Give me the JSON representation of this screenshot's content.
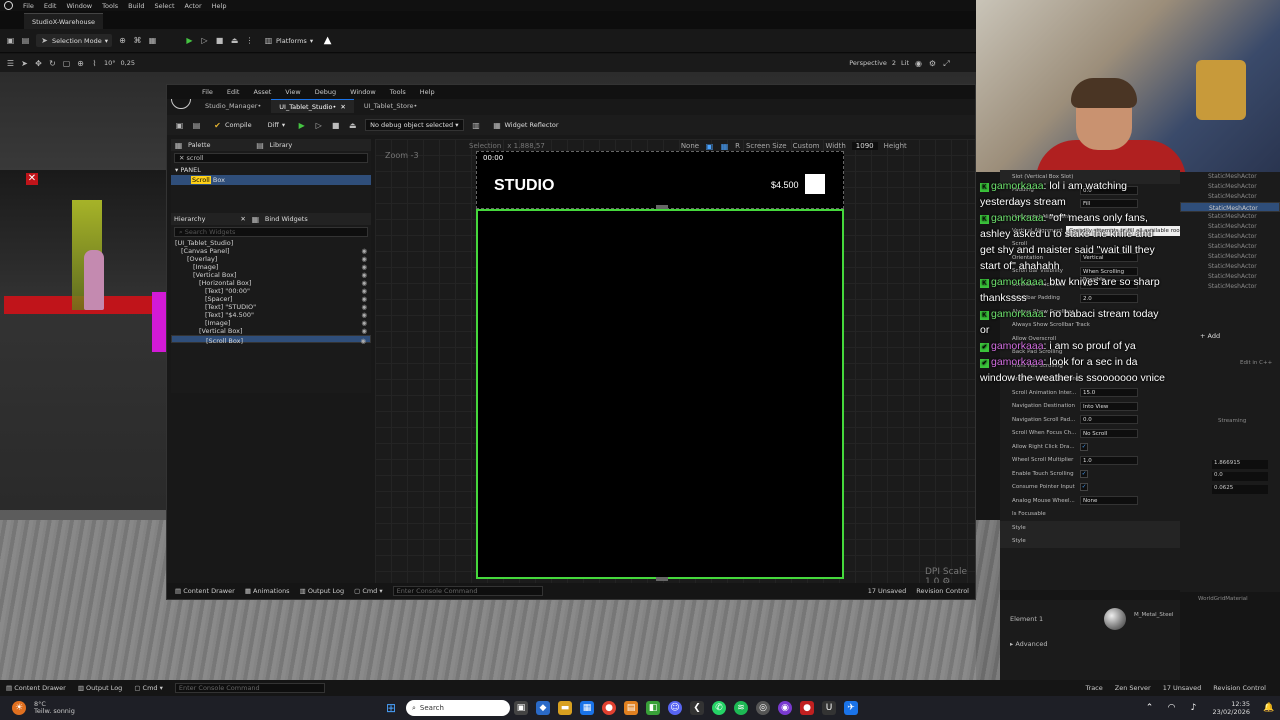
{
  "main_window": {
    "menu": [
      "File",
      "Edit",
      "Window",
      "Tools",
      "Build",
      "Select",
      "Actor",
      "Help"
    ],
    "tab": "StudioX-Warehouse",
    "toolbar": {
      "selection_mode": "Selection Mode",
      "platforms": "Platforms"
    },
    "viewport": {
      "perspective": "Perspective",
      "lit": "Lit",
      "snap_angle": "10°",
      "scale": "0,25",
      "grid_count": "2"
    }
  },
  "widget_editor": {
    "menu": [
      "File",
      "Edit",
      "Asset",
      "View",
      "Debug",
      "Window",
      "Tools",
      "Help"
    ],
    "tabs": [
      "Studio_Manager•",
      "UI_Tablet_Studio•",
      "UI_Tablet_Store•"
    ],
    "toolbar": {
      "compile": "Compile",
      "diff": "Diff",
      "debug_select": "No debug object selected",
      "widget_reflector": "Widget Reflector"
    },
    "palette": {
      "title": "Palette",
      "library": "Library",
      "search": "scroll",
      "category": "PANEL",
      "item_hl": "Scroll",
      "item_rest": " Box"
    },
    "hierarchy": {
      "title": "Hierarchy",
      "bind": "Bind Widgets",
      "search_placeholder": "Search Widgets",
      "nodes": [
        "[UI_Tablet_Studio]",
        "[Canvas Panel]",
        "[Overlay]",
        "[Image]",
        "[Vertical Box]",
        "[Horizontal Box]",
        "[Text] \"00:00\"",
        "[Spacer]",
        "[Text] \"STUDIO\"",
        "[Text] \"$4.500\"",
        "[Image]",
        "[Vertical Box]",
        "[Scroll Box]"
      ]
    },
    "designer": {
      "zoom": "Zoom -3",
      "selection": "Selection",
      "size_readout": "x 1.888,57",
      "screen_size": "Screen Size",
      "custom": "Custom",
      "width_label": "Width",
      "width": "1090",
      "height_label": "Height",
      "none": "None",
      "dpi": "DPI Scale 1,0"
    },
    "preview": {
      "clock": "00:00",
      "title": "STUDIO",
      "price": "$4.500"
    },
    "status": {
      "content_drawer": "Content Drawer",
      "animations": "Animations",
      "output_log": "Output Log",
      "cmd": "Cmd",
      "console": "Enter Console Command",
      "unsaved": "17 Unsaved",
      "revision": "Revision Control"
    }
  },
  "details": {
    "rows": [
      {
        "label": "Slot (Vertical Box Slot)",
        "value": ""
      },
      {
        "label": "Padding",
        "value": "0.0"
      },
      {
        "label": "Size",
        "value": "Fill"
      },
      {
        "label": "Horizontal Alignment",
        "value": ""
      },
      {
        "label": "Vertical Alignment",
        "value": ""
      },
      {
        "label": "Scroll",
        "value": ""
      },
      {
        "label": "Orientation",
        "value": "Vertical"
      },
      {
        "label": "Scroll Bar Visibility",
        "value": "When Scrolling Possible"
      },
      {
        "label": "Scrollbar Thickness",
        "value": "9.0"
      },
      {
        "label": "Scrollbar Padding",
        "value": "2.0"
      },
      {
        "label": "Always Show Scrollbar",
        "value": ""
      },
      {
        "label": "Always Show Scrollbar Track",
        "value": ""
      },
      {
        "label": "Allow Overscroll",
        "value": ""
      },
      {
        "label": "Back Pad Scrolling",
        "value": ""
      },
      {
        "label": "Front Pad Scrolling",
        "value": ""
      },
      {
        "label": "Animate Wheel Scrolling",
        "value": ""
      },
      {
        "label": "Scroll Animation Inter...",
        "value": "15.0"
      },
      {
        "label": "Navigation Destination",
        "value": "Into View"
      },
      {
        "label": "Navigation Scroll Pad...",
        "value": "0.0"
      },
      {
        "label": "Scroll When Focus Ch...",
        "value": "No Scroll"
      },
      {
        "label": "Allow Right Click Dra...",
        "value": "✓"
      },
      {
        "label": "Wheel Scroll Multiplier",
        "value": "1.0"
      },
      {
        "label": "Enable Touch Scrolling",
        "value": "✓"
      },
      {
        "label": "Consume Pointer Input",
        "value": "✓"
      },
      {
        "label": "Analog Mouse Wheel...",
        "value": "None"
      },
      {
        "label": "Is Focusable",
        "value": ""
      },
      {
        "label": "Style",
        "value": ""
      },
      {
        "label": "Style",
        "value": ""
      }
    ],
    "tooltip": "Greedily attempts to fill all available room based on the percentage value 0..1",
    "element": "Element 1",
    "material": "M_Metal_Steel",
    "advanced": "Advanced",
    "world_grid": "WorldGridMaterial"
  },
  "chat": [
    {
      "user": "gamorkaaa",
      "text": "lol i am watching yesterdays stream",
      "badge": "green"
    },
    {
      "user": "gamorkaaa",
      "text": "\"of\" means only fans, ashley asked u to stake the knife and get shy and maister said \"wait till they start of\" ahahahh",
      "badge": "green"
    },
    {
      "user": "gamorkaaa",
      "text": "btw knives are so sharp thankssss",
      "badge": "green"
    },
    {
      "user": "gamorkaaa",
      "text": "no babaci stream today or",
      "badge": "green"
    },
    {
      "user": "gamorkaaa",
      "text": "i am so prouf of ya",
      "badge": "pink"
    },
    {
      "user": "gamorkaaa",
      "text": "look for a sec in da window the weather is ssooooooo vnice",
      "badge": "pink"
    }
  ],
  "outliner": {
    "items": [
      "StaticMeshActor",
      "StaticMeshActor",
      "StaticMeshActor",
      "StaticMeshActor",
      "StaticMeshActor",
      "StaticMeshActor",
      "StaticMeshActor",
      "StaticMeshActor",
      "StaticMeshActor",
      "StaticMeshActor",
      "StaticMeshActor",
      "StaticMeshActor"
    ],
    "add": "Add",
    "edit_cpp": "Edit in C++",
    "streaming": "Streaming",
    "values": [
      "1.866915",
      "0.0",
      "0.0625"
    ]
  },
  "bottom_status": {
    "content_drawer": "Content Drawer",
    "output_log": "Output Log",
    "cmd": "Cmd",
    "console": "Enter Console Command",
    "trace": "Trace",
    "zen": "Zen Server",
    "unsaved": "17 Unsaved",
    "revision": "Revision Control"
  },
  "taskbar": {
    "weather_temp": "8°C",
    "weather_desc": "Teilw. sonnig",
    "search": "Search",
    "time": "12:35",
    "date": "23/02/2026"
  }
}
